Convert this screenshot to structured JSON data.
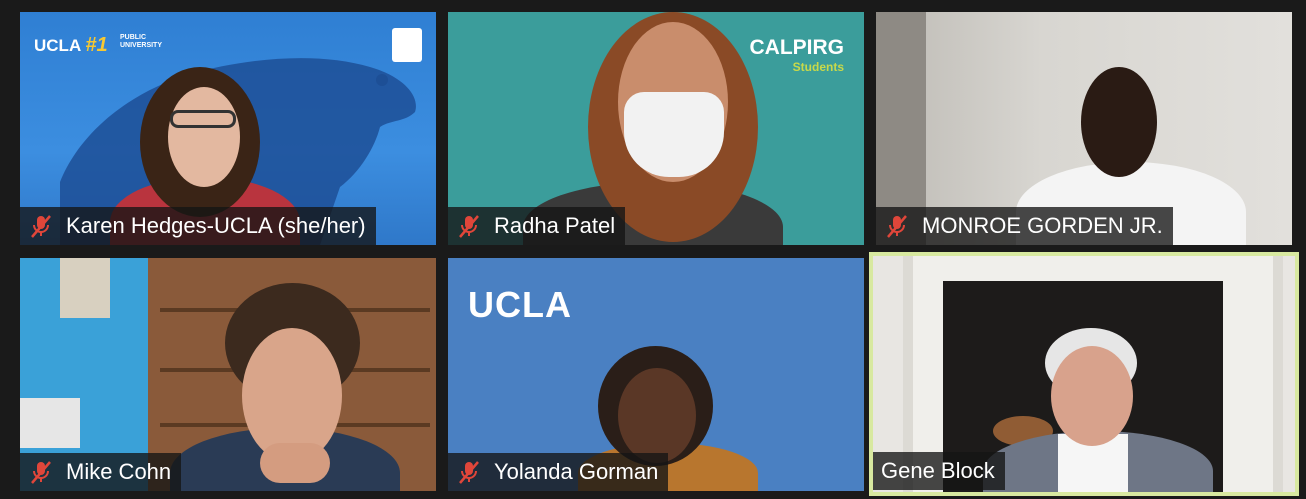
{
  "participants": [
    {
      "name": "Karen Hedges-UCLA  (she/her)",
      "muted": true,
      "logo": {
        "ucla": "UCLA",
        "rank": "#1",
        "sub1": "PUBLIC",
        "sub2": "UNIVERSITY"
      }
    },
    {
      "name": "Radha Patel",
      "muted": true,
      "logo": {
        "title": "CALPIRG",
        "sub": "Students"
      }
    },
    {
      "name": "MONROE GORDEN JR.",
      "muted": true
    },
    {
      "name": "Mike Cohn",
      "muted": true
    },
    {
      "name": "Yolanda Gorman",
      "muted": true,
      "logo": {
        "title": "UCLA"
      }
    },
    {
      "name": "Gene Block",
      "muted": false,
      "active_speaker": true
    }
  ],
  "colors": {
    "active_border": "#d8e9a0",
    "mute_icon": "#e0463a",
    "label_bg": "rgba(20,20,20,0.78)",
    "ucla_blue": "#2f7fd3",
    "calpirg_teal": "#3b9d9b",
    "calpirg_yellow": "#c8d94a",
    "ucla_blue2": "#4a80c2"
  },
  "icons": [
    "muted-microphone-icon"
  ]
}
